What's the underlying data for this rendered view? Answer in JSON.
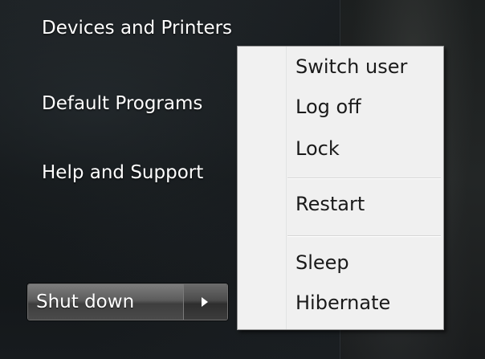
{
  "start_menu": {
    "links": [
      {
        "label": "Devices and Printers"
      },
      {
        "label": "Default Programs"
      },
      {
        "label": "Help and Support"
      }
    ],
    "shutdown_label": "Shut down"
  },
  "context_menu": {
    "group1": [
      "Switch user",
      "Log off",
      "Lock"
    ],
    "group2": [
      "Restart"
    ],
    "group3": [
      "Sleep",
      "Hibernate"
    ]
  }
}
